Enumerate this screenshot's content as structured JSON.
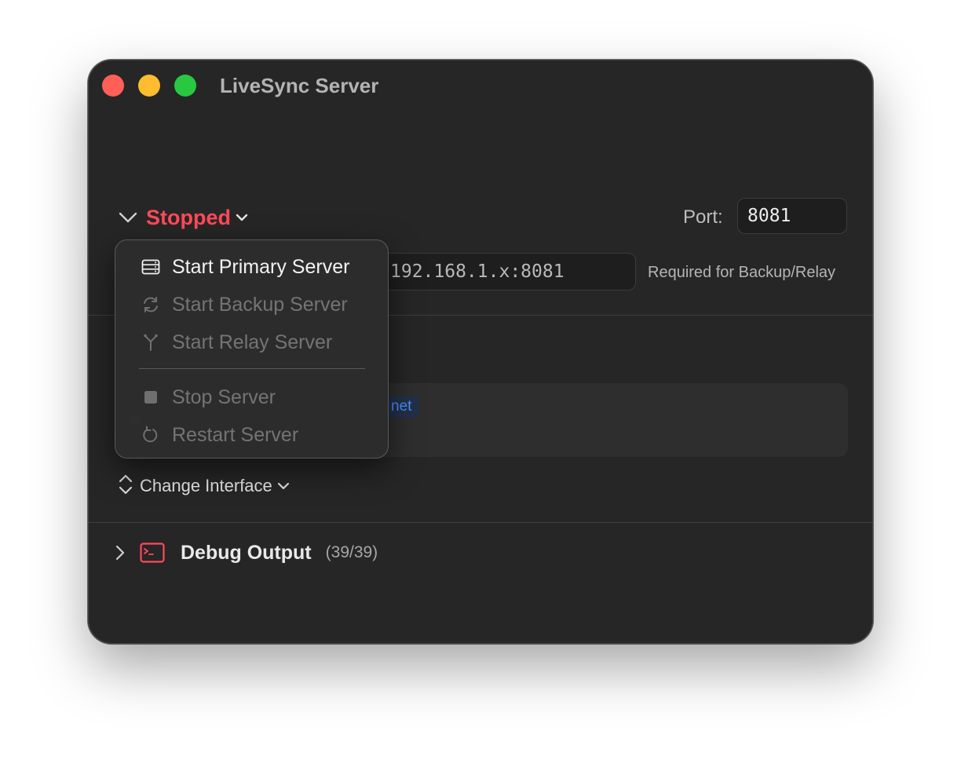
{
  "window": {
    "title": "LiveSync Server"
  },
  "status": {
    "label": "Stopped",
    "color": "#ff4a5a"
  },
  "port": {
    "label": "Port:",
    "value": "8081"
  },
  "address": {
    "value": "192.168.1.x:8081",
    "hint": "Required for Backup/Relay"
  },
  "interface": {
    "tag_partial": "net",
    "change_label": "Change Interface"
  },
  "debug": {
    "title": "Debug Output",
    "count": "(39/39)"
  },
  "menu": {
    "items": [
      {
        "label": "Start Primary Server",
        "icon": "server-rack-icon",
        "enabled": true
      },
      {
        "label": "Start Backup Server",
        "icon": "sync-arrows-icon",
        "enabled": false
      },
      {
        "label": "Start Relay Server",
        "icon": "relay-antenna-icon",
        "enabled": false
      },
      {
        "label": "Stop Server",
        "icon": "stop-square-icon",
        "enabled": false
      },
      {
        "label": "Restart Server",
        "icon": "restart-arrow-icon",
        "enabled": false
      }
    ]
  },
  "colors": {
    "window_bg": "#262626",
    "accent_blue": "#4c8dff",
    "status_red": "#ff4a5a",
    "traffic_close": "#ff5f57",
    "traffic_min": "#febc2e",
    "traffic_max": "#28c840"
  }
}
